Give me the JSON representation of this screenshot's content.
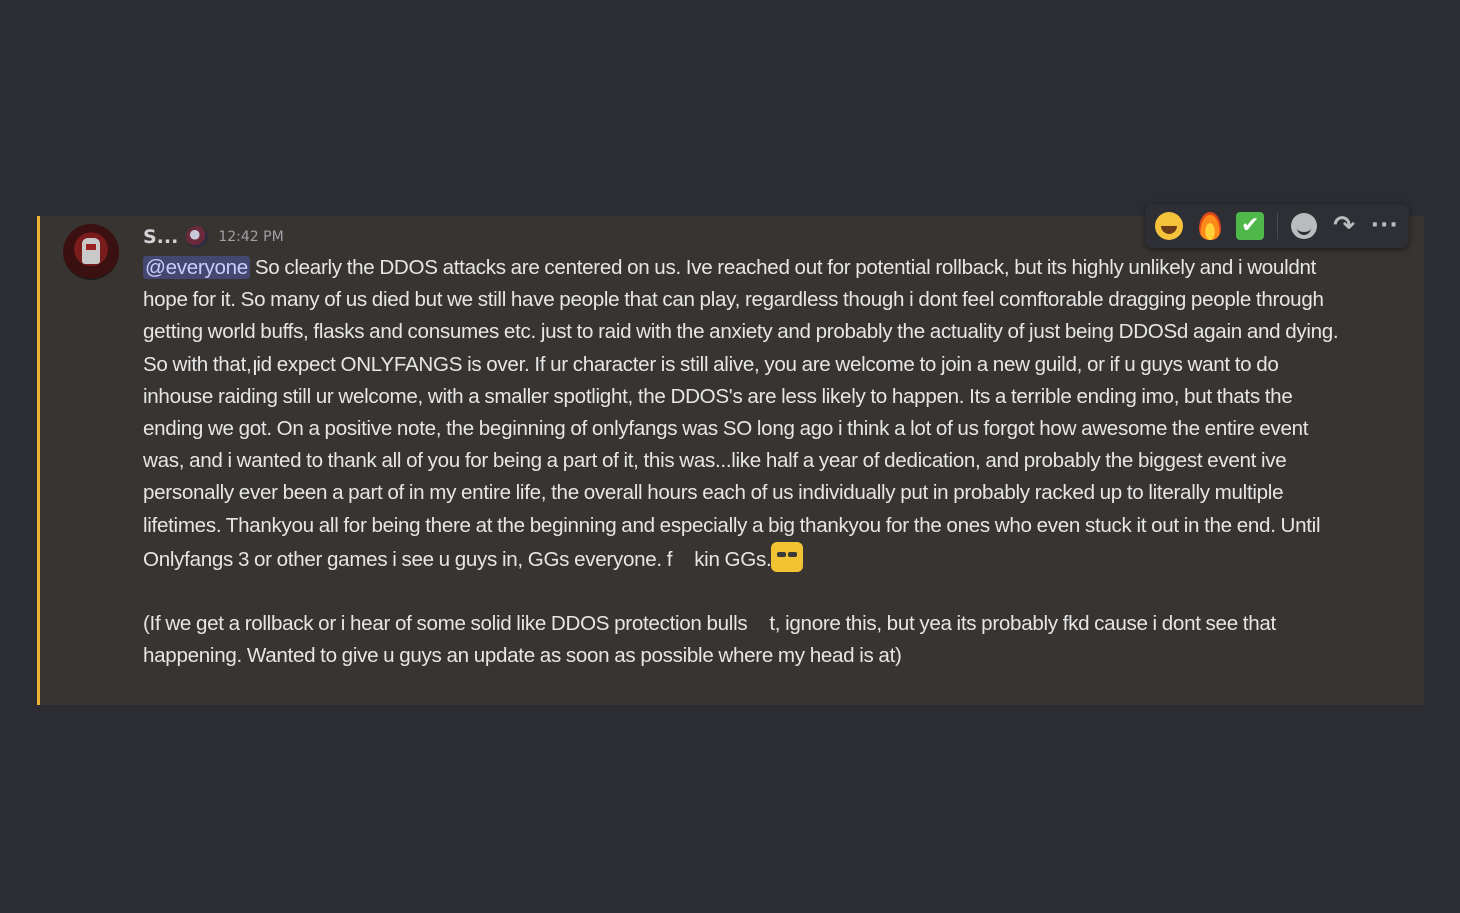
{
  "message": {
    "username": "S...",
    "timestamp": "12:42 PM",
    "mention": "@everyone",
    "text_part1": " So clearly the DDOS attacks are centered on us. Ive reached out for potential rollback, but its highly unlikely and i wouldnt hope for it. So many of us died but we still have people that can play, regardless though i dont feel comftorable dragging people through getting world buffs, flasks and consumes etc. just to raid with the anxiety and probably the actuality of just being DDOSd again and dying. So with that, id expect ONLYFANGS is over. If ur character is still alive, you are welcome to join a new guild, or if u guys want to do inhouse raiding still ur welcome, with a smaller spotlight, the DDOS's are less likely to happen. Its a terrible ending imo, but thats the ending we got. On a positive note, the beginning of onlyfangs was SO long ago i think a lot of us forgot how awesome the entire event was, and i wanted to thank all of you for being a part of it, this was...like half a year of dedication, and probably the biggest event ive personally ever been a part of in my entire life, the overall hours each of us individually put in probably racked up to literally multiple lifetimes. Thankyou all for being there at the beginning and especially a big thankyou for the ones who even stuck it out in the end. Until Onlyfangs 3 or other games i see u guys in, GGs everyone. f",
    "text_part2": "kin GGs.",
    "para2_part1": "(If we get a rollback or i hear of some solid like DDOS protection bulls",
    "para2_part2": "t, ignore this, but yea its probably fkd cause i dont see that happening. Wanted to give u guys an update as soon as possible where my head is at)",
    "accent_color": "#f0b232",
    "mention_color": "#c9cdfb"
  },
  "toolbar": {
    "check_glyph": "✔",
    "reply_glyph": "↷",
    "more_glyph": "···",
    "icons": [
      "laughing-emoji-icon",
      "fire-emoji-icon",
      "check-emoji-icon",
      "add-reaction-icon",
      "reply-icon",
      "more-icon"
    ]
  }
}
